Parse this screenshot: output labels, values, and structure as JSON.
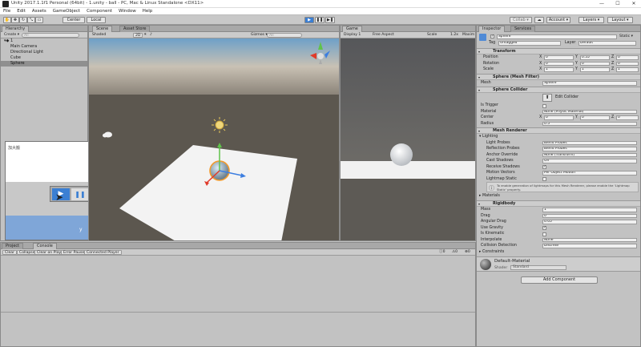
{
  "window": {
    "title": "Unity 2017.1.1f1 Personal (64bit) - 1.unity - ball - PC, Mac & Linux Standalone <DX11>",
    "minimize": "—",
    "maximize": "☐",
    "close": "✕"
  },
  "menu": [
    "File",
    "Edit",
    "Assets",
    "GameObject",
    "Component",
    "Window",
    "Help"
  ],
  "toolbar": {
    "center": "Center",
    "local": "Local",
    "collab": "Collab ▾",
    "account": "Account ▾",
    "layers": "Layers ▾",
    "layout": "Layout ▾"
  },
  "hierarchy": {
    "tab": "Hierarchy",
    "create": "Create ▾",
    "search": "All",
    "scene": "1",
    "items": [
      "Main Camera",
      "Directional Light",
      "Cube",
      "Sphere"
    ],
    "selected": 3
  },
  "scene": {
    "tab": "Scene",
    "tab2": "Asset Store",
    "shaded": "Shaded",
    "mode2d": "2D",
    "gizmos": "Gizmos ▾",
    "search": "All"
  },
  "game": {
    "tab": "Game",
    "display": "Display 1",
    "aspect": "Free Aspect",
    "scale_label": "Scale",
    "scale_value": "1.2x",
    "maximize": "Maxim"
  },
  "floating": {
    "title": "加大搬"
  },
  "bottom": {
    "tabs": [
      "Project",
      "Console"
    ],
    "buttons": [
      "Clear",
      "Collapse",
      "Clear on Play",
      "Error Pause",
      "Connected Player"
    ],
    "counts": [
      "0",
      "0",
      "0"
    ]
  },
  "inspector": {
    "tabs": [
      "Inspector",
      "Services"
    ],
    "name": "Sphere",
    "static": "Static ▾",
    "tag_label": "Tag",
    "tag": "Untagged",
    "layer_label": "Layer",
    "layer": "Default",
    "transform": {
      "title": "Transform",
      "rows": [
        {
          "label": "Position",
          "x": "0",
          "y": "0.55",
          "z": "0"
        },
        {
          "label": "Rotation",
          "x": "0",
          "y": "0",
          "z": "0"
        },
        {
          "label": "Scale",
          "x": "1",
          "y": "1",
          "z": "1"
        }
      ]
    },
    "meshfilter": {
      "title": "Sphere (Mesh Filter)",
      "mesh_label": "Mesh",
      "mesh": "Sphere"
    },
    "collider": {
      "title": "Sphere Collider",
      "edit": "Edit Collider",
      "trigger": "Is Trigger",
      "material_label": "Material",
      "material": "None (Physic Material)",
      "center_label": "Center",
      "cx": "0",
      "cy": "0",
      "cz": "0",
      "radius_label": "Radius",
      "radius": "0.5"
    },
    "renderer": {
      "title": "Mesh Renderer",
      "lighting": "Lighting",
      "rows": [
        {
          "label": "Light Probes",
          "value": "Blend Probes"
        },
        {
          "label": "Reflection Probes",
          "value": "Blend Probes"
        },
        {
          "label": "Anchor Override",
          "value": "None (Transform)"
        },
        {
          "label": "Cast Shadows",
          "value": "On"
        },
        {
          "label": "Receive Shadows",
          "value": ""
        },
        {
          "label": "Motion Vectors",
          "value": "Per Object Motion"
        },
        {
          "label": "Lightmap Static",
          "value": ""
        }
      ],
      "info": "To enable generation of lightmaps for this Mesh Renderer, please enable the 'Lightmap Static' property.",
      "materials": "Materials"
    },
    "rigidbody": {
      "title": "Rigidbody",
      "rows": [
        {
          "label": "Mass",
          "value": "1"
        },
        {
          "label": "Drag",
          "value": "0"
        },
        {
          "label": "Angular Drag",
          "value": "0.05"
        },
        {
          "label": "Use Gravity",
          "value": ""
        },
        {
          "label": "Is Kinematic",
          "value": ""
        },
        {
          "label": "Interpolate",
          "value": "None"
        },
        {
          "label": "Collision Detection",
          "value": "Discrete"
        }
      ],
      "constraints": "Constraints"
    },
    "material": {
      "name": "Default-Material",
      "shader_label": "Shader",
      "shader": "Standard"
    },
    "add_component": "Add Component"
  }
}
